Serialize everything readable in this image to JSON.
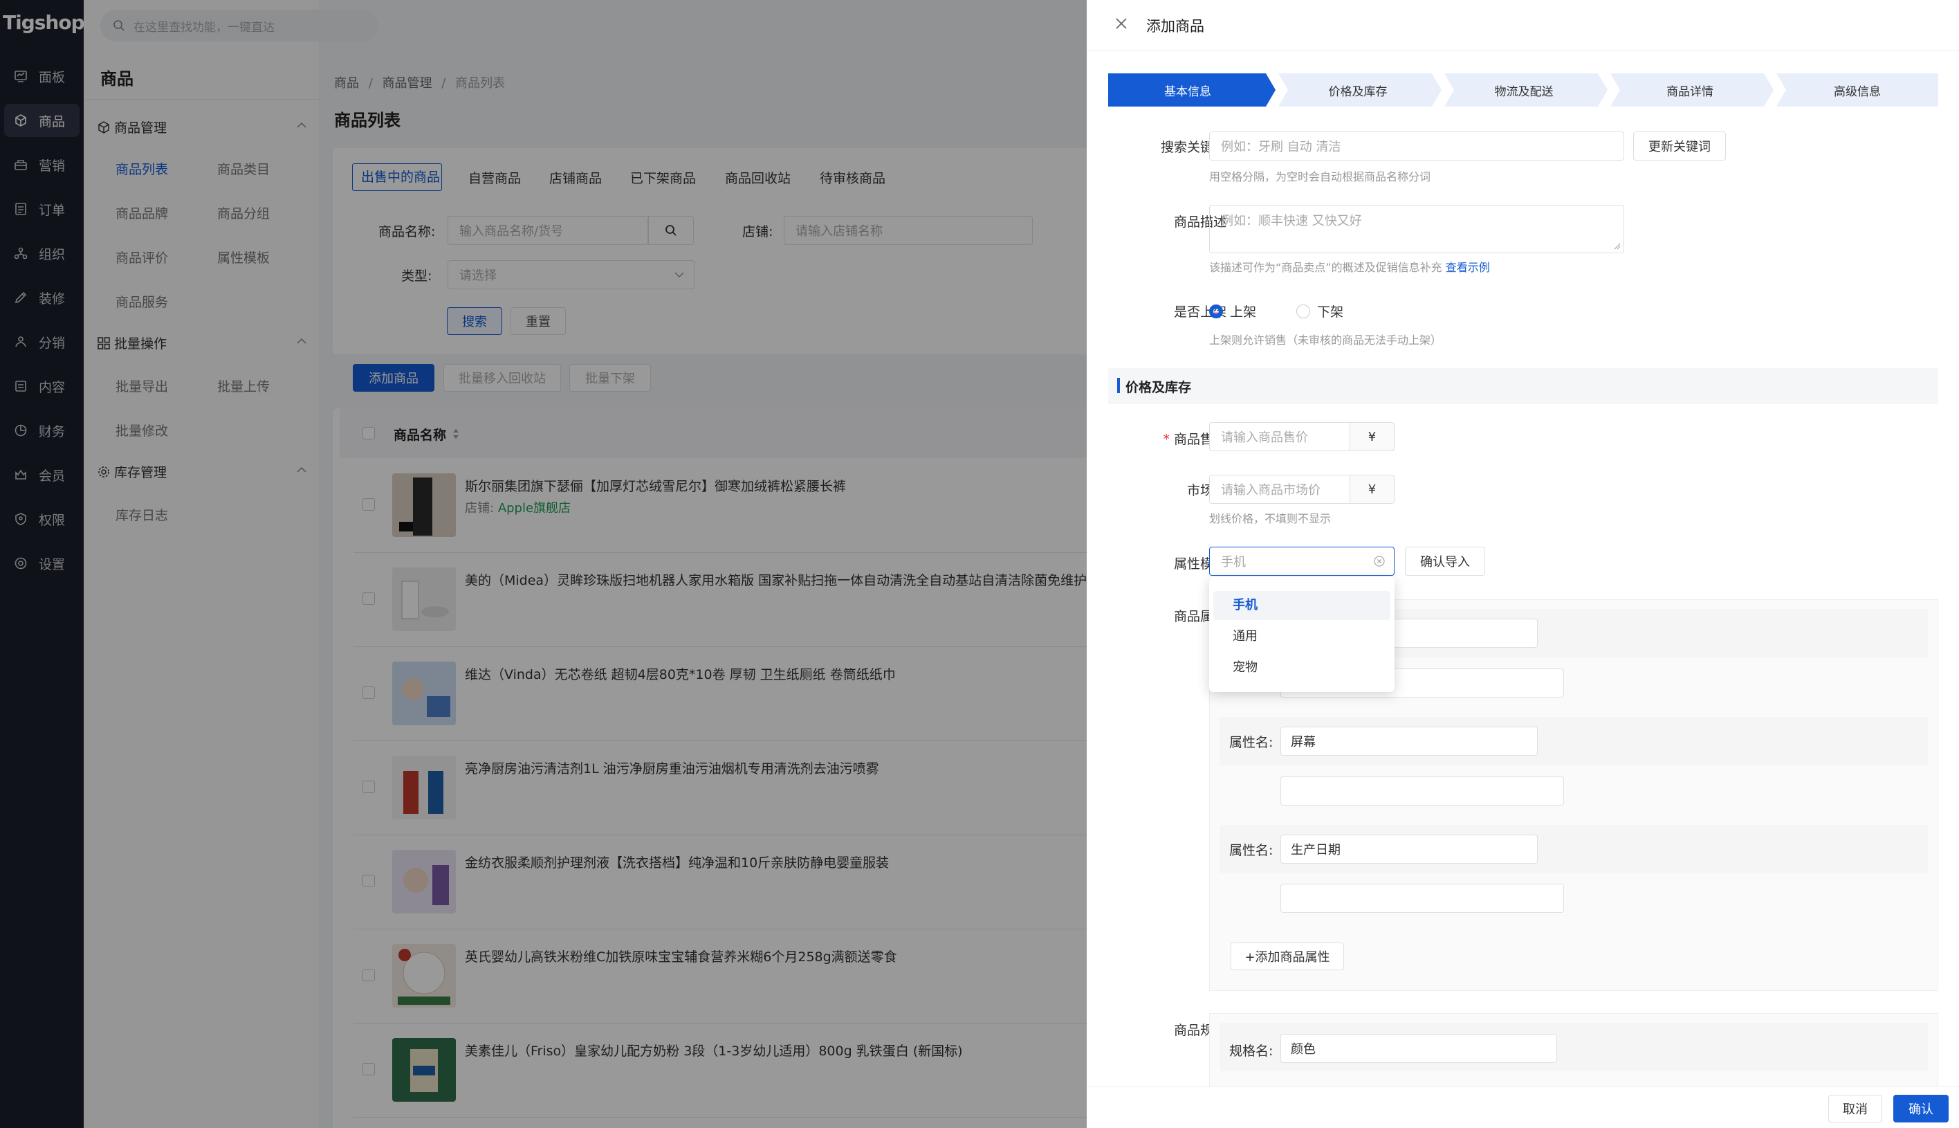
{
  "app": {
    "logo": "Tigshop",
    "search_placeholder": "在这里查找功能，一键直达"
  },
  "nav": [
    {
      "label": "面板",
      "icon": "dashboard-icon"
    },
    {
      "label": "商品",
      "icon": "box-icon",
      "active": true
    },
    {
      "label": "营销",
      "icon": "marketing-icon"
    },
    {
      "label": "订单",
      "icon": "order-icon"
    },
    {
      "label": "组织",
      "icon": "org-icon"
    },
    {
      "label": "装修",
      "icon": "decor-icon"
    },
    {
      "label": "分销",
      "icon": "distribution-icon"
    },
    {
      "label": "内容",
      "icon": "content-icon"
    },
    {
      "label": "财务",
      "icon": "finance-icon"
    },
    {
      "label": "会员",
      "icon": "member-icon"
    },
    {
      "label": "权限",
      "icon": "permission-icon"
    },
    {
      "label": "设置",
      "icon": "settings-icon"
    }
  ],
  "submenu": {
    "title": "商品",
    "groups": [
      {
        "label": "商品管理",
        "items": [
          "商品列表",
          "商品类目",
          "商品品牌",
          "商品分组",
          "商品评价",
          "属性模板",
          "商品服务"
        ]
      },
      {
        "label": "批量操作",
        "items": [
          "批量导出",
          "批量上传",
          "批量修改"
        ]
      },
      {
        "label": "库存管理",
        "items": [
          "库存日志"
        ]
      }
    ]
  },
  "main": {
    "breadcrumb": [
      "商品",
      "商品管理",
      "商品列表"
    ],
    "title": "商品列表",
    "tabs": [
      "出售中的商品",
      "自营商品",
      "店铺商品",
      "已下架商品",
      "商品回收站",
      "待审核商品"
    ],
    "filter": {
      "name_label": "商品名称:",
      "name_placeholder": "输入商品名称/货号",
      "shop_label": "店铺:",
      "shop_placeholder": "请输入店铺名称",
      "type_label": "类型:",
      "type_placeholder": "请选择",
      "search_btn": "搜索",
      "reset_btn": "重置"
    },
    "actions": {
      "add": "添加商品",
      "recycle": "批量移入回收站",
      "offshelf": "批量下架"
    },
    "table_header": "商品名称",
    "products": [
      {
        "name": "斯尔丽集团旗下瑟俪【加厚灯芯绒雪尼尔】御寒加绒裤松紧腰长裤",
        "shop_label": "店铺:",
        "shop": "Apple旗舰店"
      },
      {
        "name": "美的（Midea）灵眸珍珠版扫地机器人家用水箱版 国家补贴扫拖一体自动清洗全自动基站自清洁除菌免维护擦"
      },
      {
        "name": "维达（Vinda）无芯卷纸 超韧4层80克*10卷 厚韧 卫生纸厕纸 卷筒纸纸巾"
      },
      {
        "name": "亮净厨房油污清洁剂1L 油污净厨房重油污油烟机专用清洗剂去油污喷雾"
      },
      {
        "name": "金纺衣服柔顺剂护理剂液【洗衣搭档】纯净温和10斤亲肤防静电婴童服装"
      },
      {
        "name": "英氏婴幼儿高铁米粉维C加铁原味宝宝辅食营养米糊6个月258g满额送零食"
      },
      {
        "name": "美素佳儿（Friso）皇家幼儿配方奶粉 3段（1-3岁幼儿适用）800g 乳铁蛋白 (新国标)"
      }
    ]
  },
  "drawer": {
    "title": "添加商品",
    "steps": [
      "基本信息",
      "价格及库存",
      "物流及配送",
      "商品详情",
      "高级信息"
    ],
    "keywords": {
      "label": "搜索关键词",
      "placeholder": "例如：牙刷 自动 清洁",
      "button": "更新关键词",
      "hint": "用空格分隔，为空时会自动根据商品名称分词"
    },
    "desc": {
      "label": "商品描述",
      "placeholder": "例如：顺丰快速 又快又好",
      "hint": "该描述可作为“商品卖点”的概述及促销信息补充",
      "link": "查看示例"
    },
    "onsale": {
      "label": "是否上架",
      "opt_on": "上架",
      "opt_off": "下架",
      "hint": "上架则允许销售（未审核的商品无法手动上架）"
    },
    "section": "价格及库存",
    "price": {
      "required": "*",
      "label": "商品售价",
      "placeholder": "请输入商品售价",
      "unit": "¥"
    },
    "market": {
      "label": "市场价",
      "placeholder": "请输入商品市场价",
      "unit": "¥",
      "hint": "划线价格，不填则不显示"
    },
    "template": {
      "label": "属性模板",
      "value": "手机",
      "button": "确认导入",
      "options": [
        "手机",
        "通用",
        "宠物"
      ]
    },
    "attrs": {
      "label": "商品属性",
      "name_label": "属性名:",
      "items": [
        "",
        "",
        "屏幕",
        "生产日期"
      ],
      "add_btn": "+添加商品属性"
    },
    "spec": {
      "label": "商品规格",
      "name_label": "规格名:",
      "value": "颜色"
    },
    "footer": {
      "cancel": "取消",
      "confirm": "确认"
    }
  }
}
